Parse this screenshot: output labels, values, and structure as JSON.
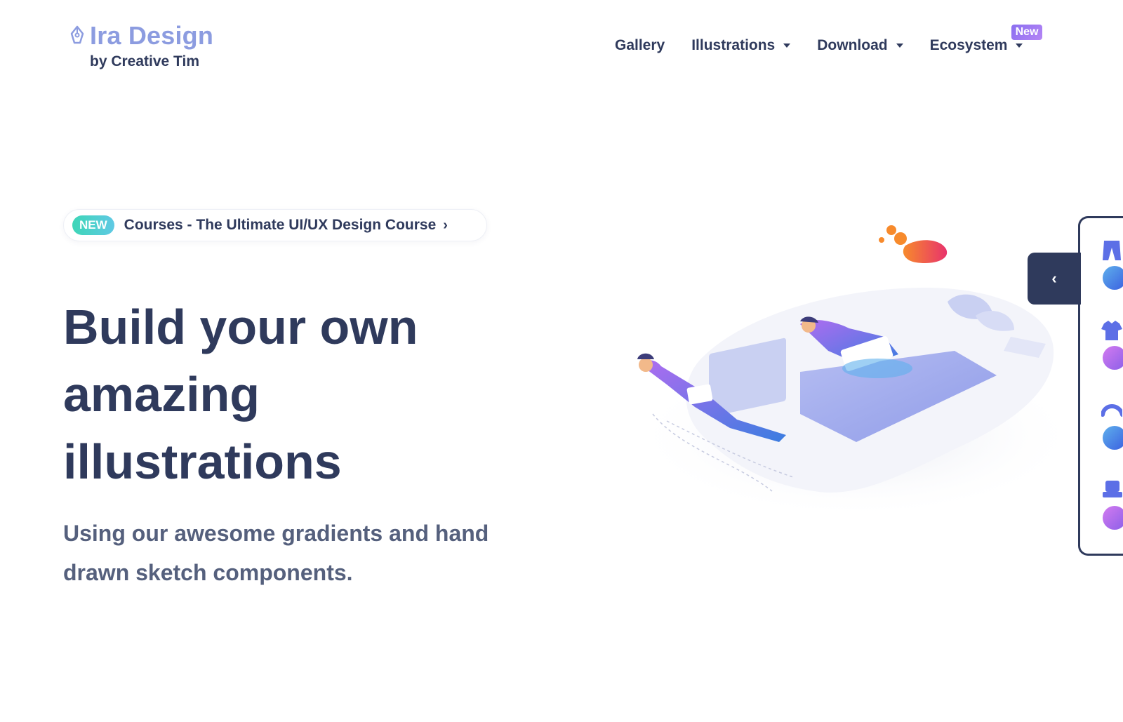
{
  "brand": {
    "name": "Ira Design",
    "subtitle": "by Creative Tim",
    "icon": "pen-nib-icon",
    "color": "#8c9ce0"
  },
  "nav": {
    "gallery": "Gallery",
    "illustrations": "Illustrations",
    "download": "Download",
    "ecosystem": "Ecosystem",
    "ecosystem_badge": "New"
  },
  "announcement": {
    "badge": "NEW",
    "text": "Courses - The Ultimate UI/UX Design Course",
    "chevron": "›"
  },
  "hero": {
    "title_lines": [
      "Build your own",
      "amazing",
      "illustrations"
    ],
    "subtitle_lines": [
      "Using our awesome gradients and hand",
      "drawn sketch components."
    ]
  },
  "side_panel": {
    "toggle": "‹",
    "items": [
      {
        "icon": "pants-icon",
        "color": "#3a7de0"
      },
      {
        "icon": "shirt-icon",
        "color": "#b06cf0"
      },
      {
        "icon": "hair-icon",
        "color": "#3a7de0"
      },
      {
        "icon": "chair-icon",
        "color": "#b06cf0"
      }
    ]
  },
  "colors": {
    "text_dark": "#2f3a5c",
    "text_muted": "#55607d",
    "accent_purple": "#8a6ff0",
    "accent_teal": "#3ed6b7"
  }
}
